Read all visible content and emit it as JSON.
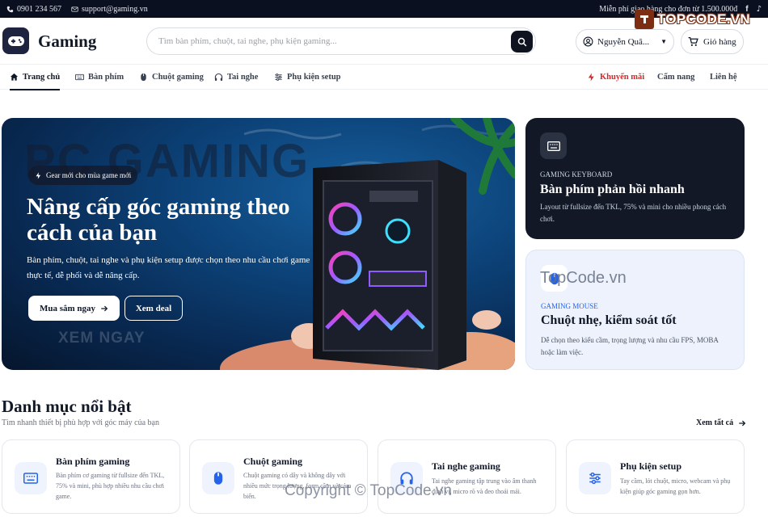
{
  "topbar": {
    "phone": "0901 234 567",
    "email": "support@gaming.vn",
    "shipping_note": "Miễn phí giao hàng cho đơn từ 1.500.000đ"
  },
  "watermark": {
    "logo_text": "TOPCODE.VN",
    "center_text": "TopCode.vn",
    "bottom_text": "Copyright © TopCode.vn"
  },
  "header": {
    "brand": "Gaming",
    "search_placeholder": "Tìm bàn phím, chuột, tai nghe, phụ kiện gaming...",
    "user_name": "Nguyễn Quâ...",
    "cart_label": "Giỏ hàng"
  },
  "nav": {
    "items": [
      {
        "label": "Trang chủ",
        "icon": "home-icon"
      },
      {
        "label": "Bàn phím",
        "icon": "keyboard-icon"
      },
      {
        "label": "Chuột gaming",
        "icon": "mouse-icon"
      },
      {
        "label": "Tai nghe",
        "icon": "headphones-icon"
      },
      {
        "label": "Phụ kiện setup",
        "icon": "sliders-icon"
      }
    ],
    "right_items": [
      {
        "label": "Khuyến mãi",
        "icon": "bolt-icon"
      },
      {
        "label": "Cẩm nang"
      },
      {
        "label": "Liên hệ"
      }
    ]
  },
  "hero": {
    "tag": "Gear mới cho mùa game mới",
    "title": "Nâng cấp góc gaming theo cách của bạn",
    "description": "Bàn phím, chuột, tai nghe và phụ kiện setup được chọn theo nhu cầu chơi game thực tế, dễ phối và dễ nâng cấp.",
    "primary_button": "Mua sắm ngay",
    "secondary_button": "Xem deal",
    "bg_word_top": "PC GAMING",
    "bg_word_bottom": "XEM NGAY"
  },
  "side_cards": [
    {
      "kicker": "GAMING KEYBOARD",
      "title": "Bàn phím phản hồi nhanh",
      "description": "Layout từ fullsize đến TKL, 75% và mini cho nhiều phong cách chơi."
    },
    {
      "kicker": "GAMING MOUSE",
      "title": "Chuột nhẹ, kiểm soát tốt",
      "description": "Dễ chọn theo kiểu cầm, trọng lượng và nhu cầu FPS, MOBA hoặc làm việc."
    }
  ],
  "categories_section": {
    "title": "Danh mục nổi bật",
    "subtitle": "Tìm nhanh thiết bị phù hợp với góc máy của bạn",
    "see_all": "Xem tất cả"
  },
  "categories": [
    {
      "title": "Bàn phím gaming",
      "description": "Bàn phím cơ gaming từ fullsize đến TKL, 75% và mini, phù hợp nhiều nhu cầu chơi game.",
      "icon": "keyboard-icon"
    },
    {
      "title": "Chuột gaming",
      "description": "Chuột gaming có dây và không dây với nhiều mức trọng lượng, form cầm và cảm biến.",
      "icon": "mouse-icon"
    },
    {
      "title": "Tai nghe gaming",
      "description": "Tai nghe gaming tập trung vào âm thanh định vị, micro rõ và đeo thoải mái.",
      "icon": "headphones-icon"
    },
    {
      "title": "Phụ kiện setup",
      "description": "Tay cầm, lót chuột, micro, webcam và phụ kiện giúp góc gaming gọn hơn.",
      "icon": "sliders-icon"
    }
  ]
}
